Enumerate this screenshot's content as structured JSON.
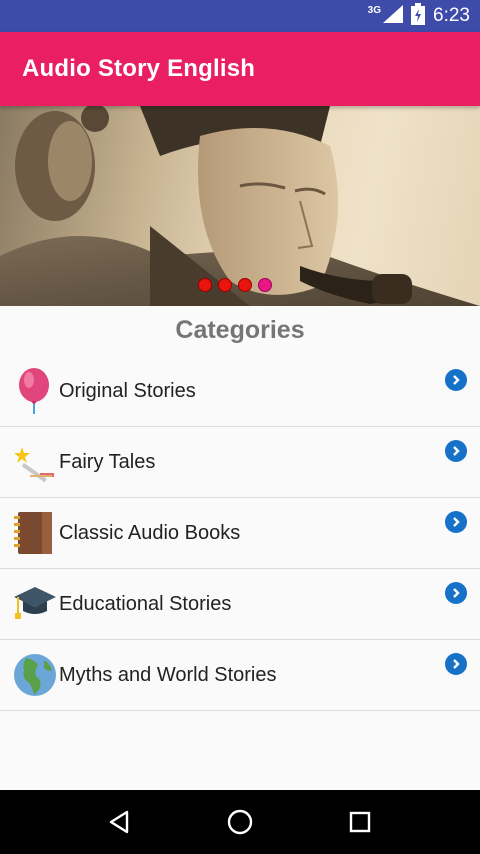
{
  "status_bar": {
    "network_label": "3G",
    "time": "6:23",
    "icons": [
      "signal-icon",
      "battery-icon"
    ]
  },
  "app_bar": {
    "title": "Audio Story English"
  },
  "banner": {
    "slide_count": 4,
    "active_slide": 4
  },
  "categories": {
    "title": "Categories",
    "items": [
      {
        "label": "Original Stories",
        "icon": "balloon-icon"
      },
      {
        "label": "Fairy Tales",
        "icon": "magic-wand-icon"
      },
      {
        "label": "Classic Audio Books",
        "icon": "book-icon"
      },
      {
        "label": "Educational Stories",
        "icon": "graduation-cap-icon"
      },
      {
        "label": "Myths and World Stories",
        "icon": "globe-icon"
      }
    ]
  },
  "nav_bar": {
    "buttons": [
      "back-icon",
      "home-icon",
      "recents-icon"
    ]
  },
  "colors": {
    "status_bar": "#3f4ba9",
    "app_bar": "#e91e63",
    "chevron": "#1671c8",
    "section_title": "#757575"
  }
}
